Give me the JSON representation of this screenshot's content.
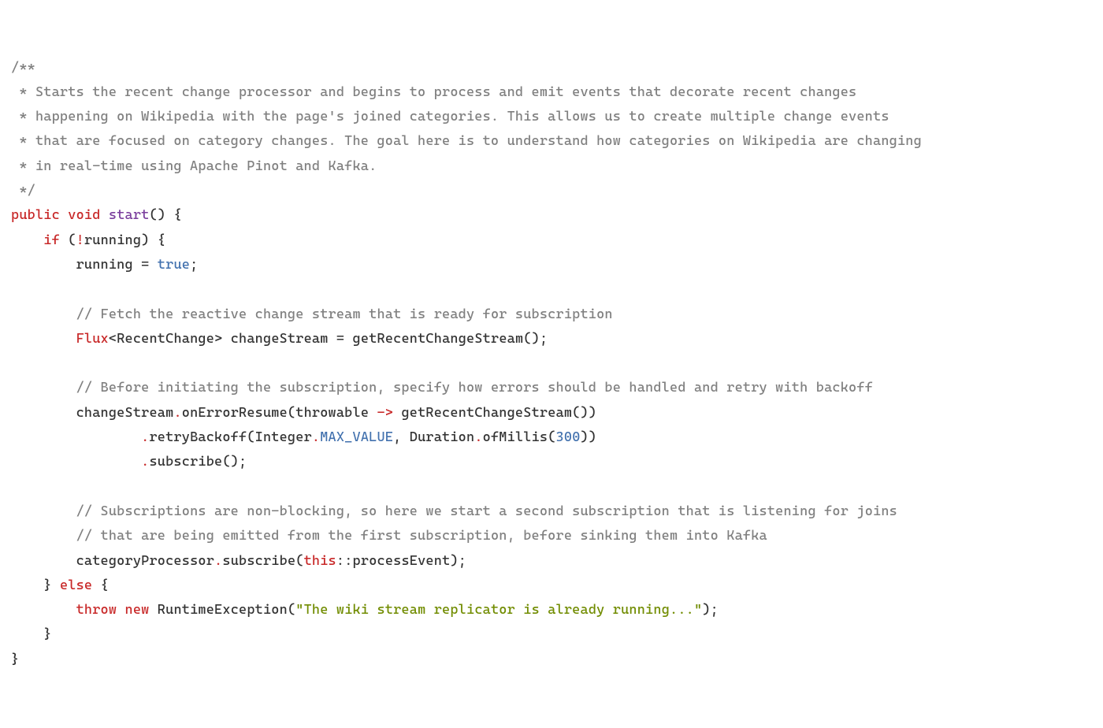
{
  "lines": {
    "c0": "/**",
    "c1": " * Starts the recent change processor and begins to process and emit events that decorate recent changes",
    "c2": " * happening on Wikipedia with the page's joined categories. This allows us to create multiple change events",
    "c3": " * that are focused on category changes. The goal here is to understand how categories on Wikipedia are changing",
    "c4": " * in real-time using Apache Pinot and Kafka.",
    "c5": " */",
    "k_public": "public",
    "k_void": "void",
    "fn_start": "start",
    "empty_parens": "()",
    "brace_open": " {",
    "brace_close": "}",
    "k_if": "if",
    "bang": "!",
    "open_paren": " (",
    "close_paren_space": ") ",
    "id_running": "running",
    "id_running2": "running",
    "assign": " = ",
    "k_true": "true",
    "semi": ";",
    "c6": "// Fetch the reactive change stream that is ready for subscription",
    "type_flux": "Flux",
    "lt": "<",
    "gt": ">",
    "type_rc": "RecentChange",
    "id_changeStream": " changeStream ",
    "eq": "=",
    "sp": " ",
    "fn_getRecent": "getRecentChangeStream()",
    "c7": "// Before initiating the subscription, specify how errors should be handled and retry with backoff",
    "id_cs": "changeStream",
    "dot": ".",
    "m_onError": "onErrorResume(throwable ",
    "arrow": "->",
    "m_onError_tail": " getRecentChangeStream())",
    "m_retry_pre": "retryBackoff(Integer",
    "const_max": "MAX_VALUE",
    "m_retry_mid": ", Duration",
    "m_ofMillis": "ofMillis(",
    "num_300": "300",
    "close2": "))",
    "m_subscribe": "subscribe()",
    "c8": "// Subscriptions are non-blocking, so here we start a second subscription that is listening for joins",
    "c9": "// that are being emitted from the first subscription, before sinking them into Kafka",
    "id_catProc": "categoryProcessor",
    "m_sub_open": "subscribe(",
    "k_this": "this",
    "dcolon": "::",
    "id_procEv": "processEvent)",
    "k_else": "else",
    "k_throw": "throw",
    "k_new": "new",
    "type_rte": " RuntimeException(",
    "str_msg": "\"The wiki stream replicator is already running...\"",
    "close_paren": ")",
    "indent1": "    ",
    "indent2": "        ",
    "indent4": "                ",
    "nl": "\n"
  }
}
